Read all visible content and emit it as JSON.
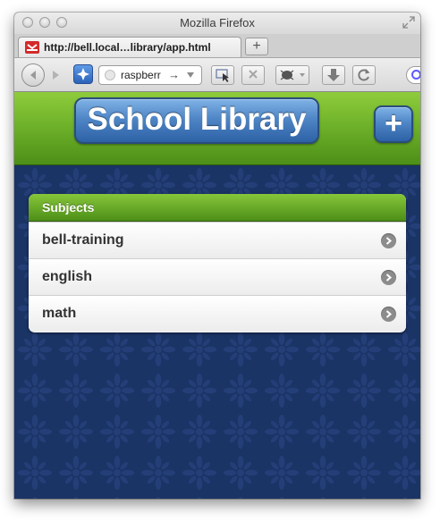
{
  "window": {
    "title": "Mozilla Firefox"
  },
  "tab": {
    "title": "http://bell.local…library/app.html",
    "new_tab_label": "+"
  },
  "toolbar": {
    "url_text": "raspberr"
  },
  "app": {
    "header_title": "School Library",
    "add_label": "+",
    "colors": {
      "header_green": "#6fb22a",
      "button_blue": "#4f86c6",
      "background_navy": "#1b3466"
    }
  },
  "subjects": {
    "header": "Subjects",
    "items": [
      {
        "label": "bell-training"
      },
      {
        "label": "english"
      },
      {
        "label": "math"
      }
    ]
  }
}
